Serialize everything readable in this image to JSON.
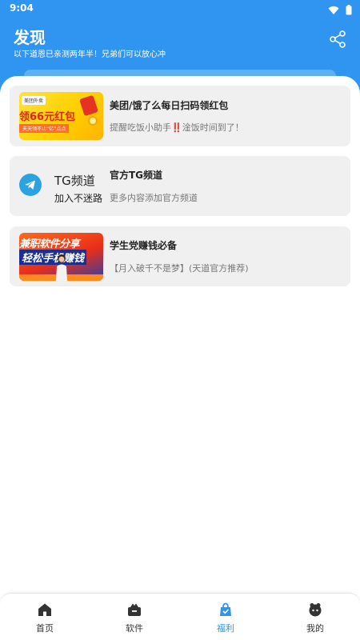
{
  "status_bar": {
    "time": "9:04",
    "icons": [
      "wifi-icon",
      "battery-icon"
    ]
  },
  "header": {
    "title": "发现",
    "subtitle": "以下道恩已亲测两年半！兄弟们可以放心冲",
    "share_icon": "share-icon",
    "background_color": "#2f95f0"
  },
  "cards": [
    {
      "title": "美团/饿了么每日扫码领红包",
      "desc_before": "提醒吃饭小助手",
      "desc_emoji": "‼️",
      "desc_after": "淦饭时间到了！",
      "thumb": {
        "tag": "美团外卖",
        "big_text": "领66元红包",
        "small_text": "天天领不止“亿”点点"
      }
    },
    {
      "title": "官方TG频道",
      "desc": "更多内容添加官方频道",
      "thumb": {
        "name": "TG频道",
        "sub": "加入不迷路",
        "icon": "telegram-icon"
      }
    },
    {
      "title": "学生党赚钱必备",
      "desc": "【月入破千不是梦】(天道官方推荐)",
      "thumb": {
        "line1": "兼职软件分享",
        "line2": "轻松手机赚钱"
      }
    }
  ],
  "bottom_nav": {
    "active_color": "#2f95f0",
    "items": [
      {
        "label": "首页",
        "icon": "home-icon"
      },
      {
        "label": "软件",
        "icon": "software-box-icon"
      },
      {
        "label": "福利",
        "icon": "welfare-bag-icon",
        "active": true
      },
      {
        "label": "我的",
        "icon": "profile-icon"
      }
    ]
  }
}
